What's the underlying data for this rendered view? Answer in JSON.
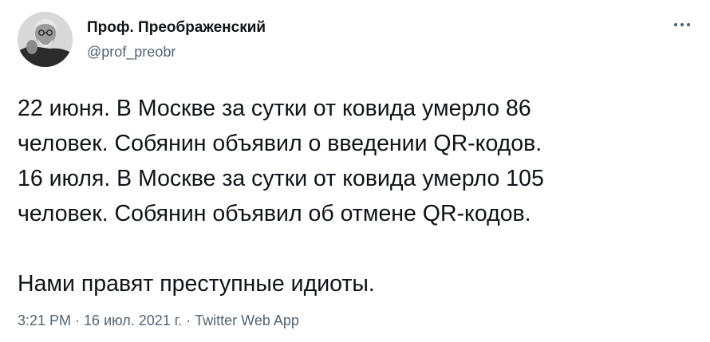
{
  "author": {
    "name": "Проф. Преображенский",
    "handle": "@prof_preobr",
    "avatar_icon": "person-portrait-avatar"
  },
  "more_icon": "more-horizontal-icon",
  "tweet": {
    "lines": [
      "22 июня. В Москве за сутки от ковида умерло 86",
      "человек. Собянин объявил о введении QR-кодов.",
      "16 июля. В Москве за сутки от ковида умерло 105",
      "человек. Собянин объявил об отмене QR-кодов.",
      "Нами правят преступные идиоты."
    ]
  },
  "meta": {
    "time": "3:21 PM",
    "separator": "·",
    "date": "16 июл. 2021 г.",
    "source": "Twitter Web App"
  },
  "colors": {
    "text": "#0f1419",
    "secondary": "#536471",
    "background": "#ffffff"
  }
}
